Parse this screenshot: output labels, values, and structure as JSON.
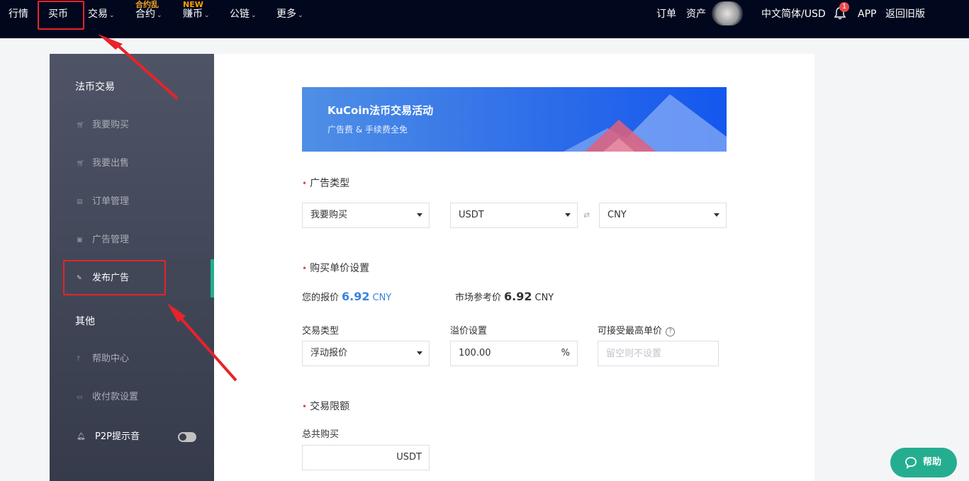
{
  "topnav": {
    "items": [
      {
        "label": "行情"
      },
      {
        "label": "买币"
      },
      {
        "label": "交易"
      },
      {
        "label": "合约"
      },
      {
        "label": "赚币"
      },
      {
        "label": "公链"
      },
      {
        "label": "更多"
      }
    ],
    "contract_badge": "合约乱",
    "earn_badge": "NEW",
    "right": {
      "orders": "订单",
      "assets": "资产",
      "language": "中文简体/USD",
      "notification_count": "1",
      "app": "APP",
      "old_version": "返回旧版"
    }
  },
  "sidebar": {
    "group1": "法币交易",
    "items": [
      {
        "label": "我要购买",
        "icon": "cart-icon"
      },
      {
        "label": "我要出售",
        "icon": "cart-icon"
      },
      {
        "label": "订单管理",
        "icon": "list-icon"
      },
      {
        "label": "广告管理",
        "icon": "ad-icon"
      },
      {
        "label": "发布广告",
        "icon": "edit-icon",
        "active": true
      }
    ],
    "group2": "其他",
    "items2": [
      {
        "label": "帮助中心",
        "icon": "help-icon"
      },
      {
        "label": "收付款设置",
        "icon": "card-icon"
      }
    ],
    "p2p_sound": {
      "label": "P2P提示音",
      "enabled": false
    }
  },
  "banner": {
    "title": "KuCoin法币交易活动",
    "subtitle": "广告费 & 手续费全免"
  },
  "ad_type": {
    "title": "广告类型",
    "side": "我要购买",
    "coin": "USDT",
    "fiat": "CNY"
  },
  "price": {
    "title": "购买单价设置",
    "your_price_label": "您的报价",
    "your_price": "6.92",
    "your_price_unit": "CNY",
    "market_label": "市场参考价",
    "market_price": "6.92",
    "market_unit": "CNY",
    "trade_type_label": "交易类型",
    "trade_type": "浮动报价",
    "premium_label": "溢价设置",
    "premium": "100.00",
    "premium_unit": "%",
    "max_price_label": "可接受最高单价",
    "max_price_placeholder": "留空则不设置"
  },
  "limit": {
    "title": "交易限额",
    "total_label": "总共购买",
    "total_unit": "USDT"
  },
  "help_button": {
    "label": "帮助"
  },
  "colors": {
    "nav_bg": "#01081e",
    "accent": "#24ae8f",
    "banner_blue": "#2f6ee8",
    "annotation_red": "#e8232a"
  }
}
